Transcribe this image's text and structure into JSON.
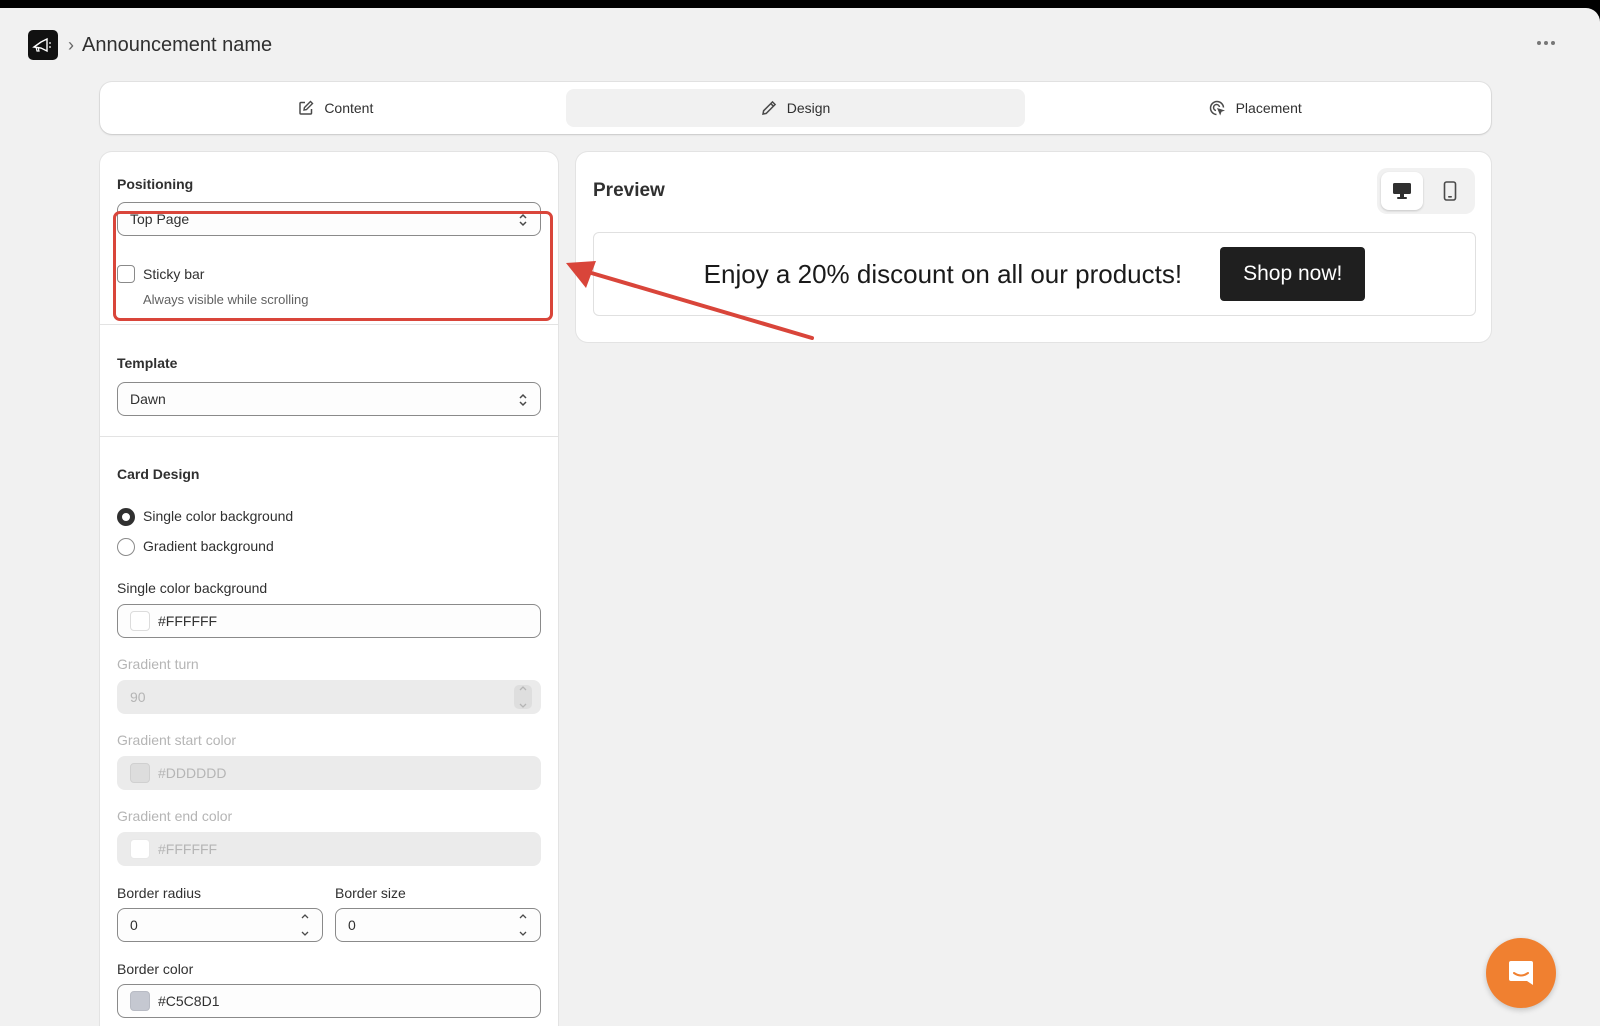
{
  "header": {
    "title": "Announcement name",
    "separator": "›"
  },
  "tabs": [
    {
      "label": "Content",
      "icon": "edit-icon"
    },
    {
      "label": "Design",
      "icon": "pencil-icon"
    },
    {
      "label": "Placement",
      "icon": "cursor-target-icon"
    }
  ],
  "active_tab": "Design",
  "positioning": {
    "title": "Positioning",
    "select_value": "Top Page",
    "sticky_label": "Sticky bar",
    "sticky_help": "Always visible while scrolling",
    "sticky_checked": false
  },
  "template": {
    "title": "Template",
    "select_value": "Dawn"
  },
  "card_design": {
    "title": "Card Design",
    "radio_single": "Single color background",
    "radio_gradient": "Gradient background",
    "selected": "Single color background",
    "single_label": "Single color background",
    "single_value": "#FFFFFF",
    "turn_label": "Gradient turn",
    "turn_value": "90",
    "start_label": "Gradient start color",
    "start_value": "#DDDDDD",
    "end_label": "Gradient end color",
    "end_value": "#FFFFFF",
    "radius_label": "Border radius",
    "radius_value": "0",
    "size_label": "Border size",
    "size_value": "0",
    "border_color_label": "Border color",
    "border_color_value": "#C5C8D1"
  },
  "preview": {
    "title": "Preview",
    "announcement_text": "Enjoy a 20% discount on all our products!",
    "button_label": "Shop now!",
    "active_device": "desktop"
  },
  "colors": {
    "highlight": "#d9453a",
    "chat": "#f08030",
    "shop_button": "#1f1f1f"
  }
}
